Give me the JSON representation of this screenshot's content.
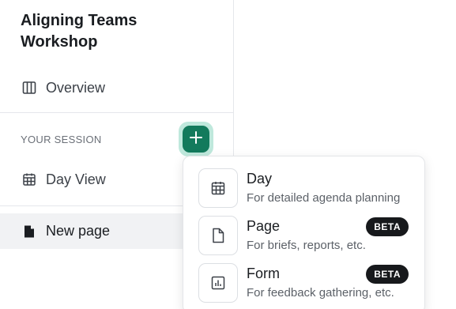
{
  "workspace": {
    "title": "Aligning Teams Workshop"
  },
  "sidebar": {
    "overview": {
      "label": "Overview",
      "icon": "columns-icon"
    },
    "section_label": "YOUR SESSION",
    "add_button": {
      "icon": "plus-icon",
      "accent": "#137a5c"
    },
    "items": [
      {
        "label": "Day View",
        "icon": "calendar-icon"
      },
      {
        "label": "New page",
        "icon": "file-icon",
        "selected": true
      }
    ]
  },
  "add_menu": {
    "items": [
      {
        "title": "Day",
        "description": "For detailed agenda planning",
        "icon": "calendar-icon",
        "badge": ""
      },
      {
        "title": "Page",
        "description": "For briefs, reports, etc.",
        "icon": "document-icon",
        "badge": "BETA"
      },
      {
        "title": "Form",
        "description": "For feedback gathering, etc.",
        "icon": "chart-icon",
        "badge": "BETA"
      }
    ]
  }
}
